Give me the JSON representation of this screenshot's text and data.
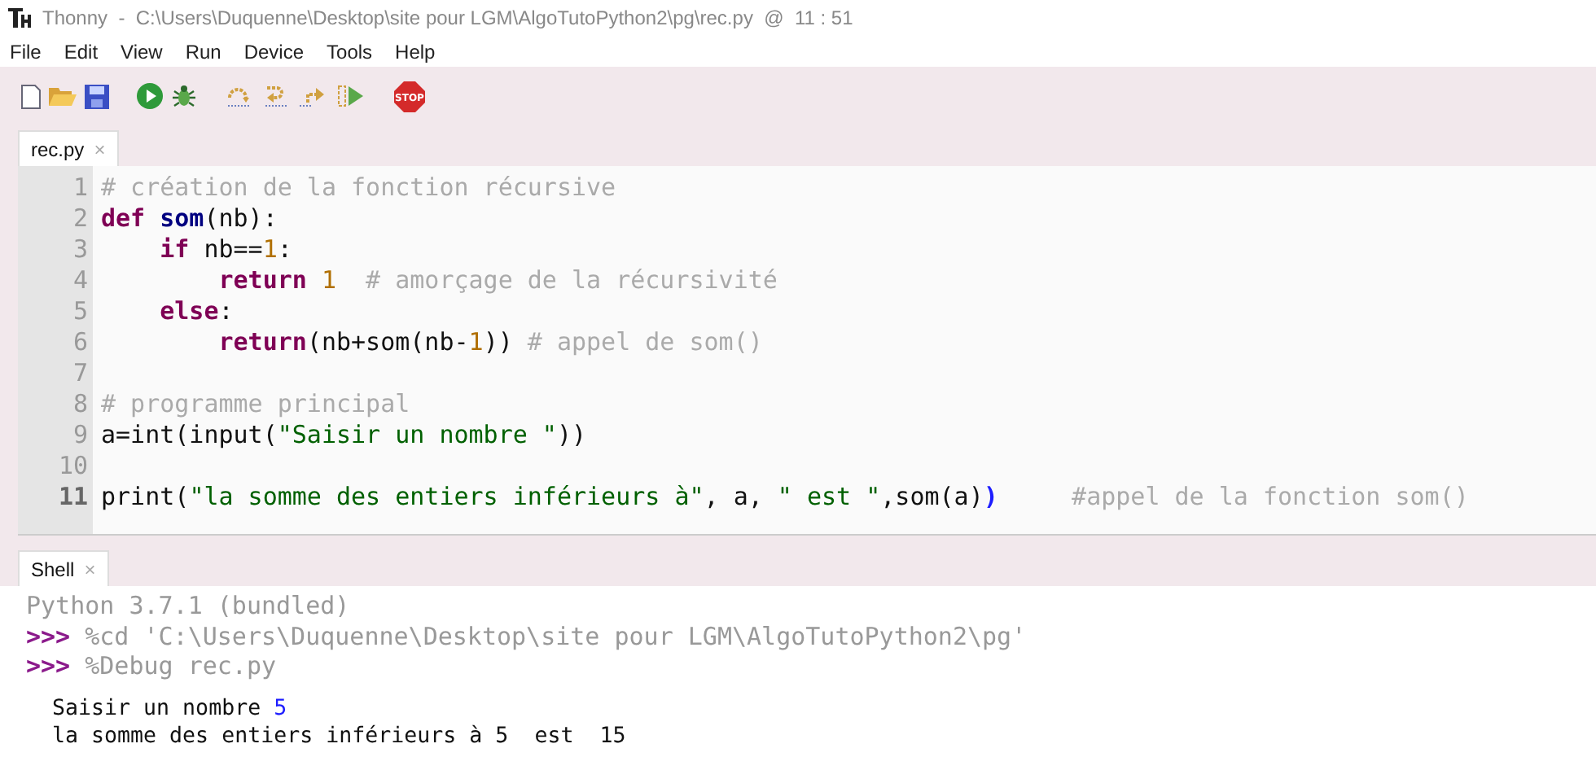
{
  "window": {
    "title": "Thonny  -  C:\\Users\\Duquenne\\Desktop\\site pour LGM\\AlgoTutoPython2\\pg\\rec.py  @  11 : 51"
  },
  "menu": [
    "File",
    "Edit",
    "View",
    "Run",
    "Device",
    "Tools",
    "Help"
  ],
  "toolbar": [
    {
      "kind": "new"
    },
    {
      "kind": "open"
    },
    {
      "kind": "save"
    },
    {
      "kind": "run"
    },
    {
      "kind": "debug"
    },
    {
      "kind": "step-over"
    },
    {
      "kind": "step-into"
    },
    {
      "kind": "step-out"
    },
    {
      "kind": "resume"
    },
    {
      "kind": "stop",
      "label": "STOP"
    }
  ],
  "editor": {
    "tab": {
      "label": "rec.py",
      "close": "×",
      "selected": true
    },
    "lines": [
      {
        "number": "1",
        "current": false,
        "tokens": [
          {
            "kind": "comment",
            "text": "# création de la fonction récursive"
          }
        ]
      },
      {
        "number": "2",
        "current": false,
        "tokens": [
          {
            "kind": "keyword",
            "text": "def "
          },
          {
            "kind": "name",
            "text": "som"
          },
          {
            "kind": "plain",
            "text": "(nb):"
          }
        ]
      },
      {
        "number": "3",
        "current": false,
        "tokens": [
          {
            "kind": "keyword",
            "text": "    if"
          },
          {
            "kind": "plain",
            "text": " nb=="
          },
          {
            "kind": "number",
            "text": "1"
          },
          {
            "kind": "plain",
            "text": ":"
          }
        ]
      },
      {
        "number": "4",
        "current": false,
        "tokens": [
          {
            "kind": "keyword",
            "text": "        return "
          },
          {
            "kind": "number",
            "text": "1"
          },
          {
            "kind": "comment",
            "text": "  # amorçage de la récursivité"
          }
        ]
      },
      {
        "number": "5",
        "current": false,
        "tokens": [
          {
            "kind": "keyword",
            "text": "    else"
          },
          {
            "kind": "plain",
            "text": ":"
          }
        ]
      },
      {
        "number": "6",
        "current": false,
        "tokens": [
          {
            "kind": "keyword",
            "text": "        return"
          },
          {
            "kind": "plain",
            "text": "(nb+som(nb-"
          },
          {
            "kind": "number",
            "text": "1"
          },
          {
            "kind": "plain",
            "text": ")) "
          },
          {
            "kind": "comment",
            "text": "# appel de som()"
          }
        ]
      },
      {
        "number": "7",
        "current": false
      },
      {
        "number": "8",
        "current": false,
        "tokens": [
          {
            "kind": "comment",
            "text": "# programme principal"
          }
        ]
      },
      {
        "number": "9",
        "current": false,
        "tokens": [
          {
            "kind": "plain",
            "text": "a=int(input("
          },
          {
            "kind": "string",
            "text": "\"Saisir un nombre \""
          },
          {
            "kind": "plain",
            "text": "))"
          }
        ]
      },
      {
        "number": "10",
        "current": false
      },
      {
        "number": "11",
        "current": true,
        "tokens": [
          {
            "kind": "plain",
            "text": "print("
          },
          {
            "kind": "string",
            "text": "\"la somme des entiers inférieurs à\""
          },
          {
            "kind": "plain",
            "text": ", a, "
          },
          {
            "kind": "string",
            "text": "\" est \""
          },
          {
            "kind": "plain",
            "text": ",som(a)"
          },
          {
            "kind": "match",
            "text": ")"
          },
          {
            "kind": "comment",
            "text": "     #appel de la fonction som()"
          }
        ]
      }
    ]
  },
  "shell": {
    "tab": {
      "label": "Shell",
      "close": "×",
      "selected": true
    },
    "lines": [
      {
        "kind": "banner",
        "tokens": [
          {
            "kind": "banner",
            "text": "Python 3.7.1 (bundled)"
          }
        ]
      },
      {
        "kind": "command",
        "tokens": [
          {
            "kind": "prompt",
            "text": ">>>"
          },
          {
            "kind": "command",
            "text": " %cd 'C:\\Users\\Duquenne\\Desktop\\site pour LGM\\AlgoTutoPython2\\pg'"
          }
        ]
      },
      {
        "kind": "command",
        "tokens": [
          {
            "kind": "prompt",
            "text": ">>>"
          },
          {
            "kind": "command",
            "text": " %Debug rec.py"
          }
        ]
      },
      {
        "kind": "output",
        "tokens": [
          {
            "kind": "output",
            "text": "Saisir un nombre "
          },
          {
            "kind": "input",
            "text": "5"
          }
        ]
      },
      {
        "kind": "output",
        "tokens": [
          {
            "kind": "output",
            "text": "la somme des entiers inférieurs à 5  est  15"
          }
        ]
      }
    ]
  }
}
